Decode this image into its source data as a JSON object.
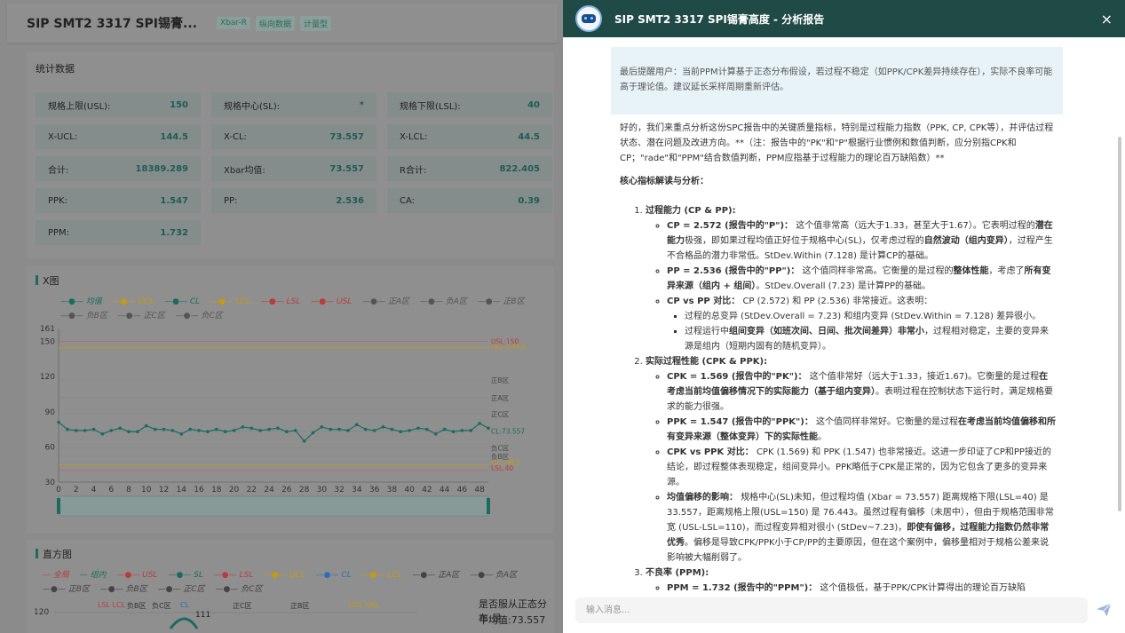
{
  "header": {
    "title": "SIP SMT2 3317 SPI锡膏...",
    "tags": [
      "Xbar-R",
      "纵向数据",
      "计量型"
    ]
  },
  "stats": {
    "title": "统计数据",
    "items": [
      {
        "label": "规格上限(USL):",
        "value": "150"
      },
      {
        "label": "规格中心(SL):",
        "value": "*"
      },
      {
        "label": "规格下限(LSL):",
        "value": "40"
      },
      {
        "label": "X-UCL:",
        "value": "144.5"
      },
      {
        "label": "X-CL:",
        "value": "73.557"
      },
      {
        "label": "X-LCL:",
        "value": "44.5"
      },
      {
        "label": "合计:",
        "value": "18389.289"
      },
      {
        "label": "Xbar均值:",
        "value": "73.557"
      },
      {
        "label": "R合计:",
        "value": "822.405"
      },
      {
        "label": "PPK:",
        "value": "1.547"
      },
      {
        "label": "PP:",
        "value": "2.536"
      },
      {
        "label": "CA:",
        "value": "0.39"
      },
      {
        "label": "PPM:",
        "value": "1.732"
      }
    ]
  },
  "xchart": {
    "title": "X图",
    "legend": [
      "均值",
      "UCL",
      "CL",
      "LCL",
      "LSL",
      "USL",
      "正A区",
      "负A区",
      "正B区",
      "负B区",
      "正C区",
      "负C区"
    ],
    "line_labels": [
      "USL:150",
      "UCL:144.5",
      "正B区",
      "正A区",
      "正C区",
      "CL:73.557",
      "负C区",
      "负B区",
      "LCL:44.5",
      "LSL:40"
    ]
  },
  "chart_data": {
    "type": "line",
    "title": "X图",
    "x": [
      0,
      1,
      2,
      3,
      4,
      5,
      6,
      7,
      8,
      9,
      10,
      11,
      12,
      13,
      14,
      15,
      16,
      17,
      18,
      19,
      20,
      21,
      22,
      23,
      24,
      25,
      26,
      27,
      28,
      29,
      30,
      31,
      32,
      33,
      34,
      35,
      36,
      37,
      38,
      39,
      40,
      41,
      42,
      43,
      44,
      45,
      46,
      47,
      48,
      49
    ],
    "series": [
      {
        "name": "均值",
        "values": [
          81,
          75,
          74,
          74,
          75,
          71,
          74,
          76,
          73,
          73,
          78,
          75,
          75,
          74,
          71,
          75,
          74,
          73,
          75,
          73,
          74,
          77,
          76,
          74,
          75,
          76,
          73,
          74,
          65,
          72,
          77,
          75,
          75,
          74,
          79,
          75,
          74,
          77,
          75,
          73,
          74,
          76,
          75,
          71,
          75,
          73,
          74,
          74,
          80,
          76
        ]
      }
    ],
    "reference_lines": [
      {
        "name": "USL",
        "value": 150
      },
      {
        "name": "UCL",
        "value": 144.5
      },
      {
        "name": "CL",
        "value": 73.557
      },
      {
        "name": "LCL",
        "value": 44.5
      },
      {
        "name": "LSL",
        "value": 40
      }
    ],
    "ylim": [
      30,
      161
    ],
    "yticks": [
      30,
      60,
      90,
      120,
      150,
      161
    ],
    "xticks": [
      0,
      2,
      4,
      6,
      8,
      10,
      12,
      14,
      16,
      18,
      20,
      22,
      24,
      26,
      28,
      30,
      32,
      34,
      36,
      38,
      40,
      42,
      44,
      46,
      48
    ]
  },
  "histogram": {
    "title": "直方图",
    "legend": [
      "全局",
      "组内",
      "USL",
      "SL",
      "LSL",
      "UCL",
      "CL",
      "LCL",
      "正A区",
      "负A区",
      "正B区",
      "负B区",
      "正C区",
      "负C区"
    ],
    "axis_top_labels": [
      "LSL LCL",
      "负B区",
      "负C区",
      "CL",
      "正C区",
      "正B区",
      "UCL USL"
    ],
    "y_tick": "120",
    "peak_label": "111",
    "right_text": [
      "是否服从正态分布:是",
      "平均值:73.557"
    ]
  },
  "panel": {
    "title": "SIP SMT2 3317 SPI锡膏高度 - 分析报告",
    "close": "×",
    "note": "最后提醒用户：当前PPM计算基于正态分布假设，若过程不稳定（如PPK/CPK差异持续存在），实际不良率可能高于理论值。建议延长采样周期重新评估。",
    "intro": "好的，我们来重点分析这份SPC报告中的关键质量指标，特别是过程能力指数（PPK, CP, CPK等），并评估过程状态、潜在问题及改进方向。**（注：报告中的\"PK\"和\"P\"根据行业惯例和数值判断，应分别指CPK和CP；\"rade\"和\"PPM\"结合数值判断，PPM应指基于过程能力的理论百万缺陷数）**",
    "heading": "核心指标解读与分析：",
    "s1": "过程能力 (CP & PP):",
    "s1a_b": "CP = 2.572 (报告中的\"P\")：",
    "s1a": "这个值非常高（远大于1.33，甚至大于1.67）。它表明过程的",
    "s1a_b2": "潜在能力",
    "s1a2": "极强，即如果过程均值正好位于规格中心(SL)，仅考虑过程的",
    "s1a_b3": "自然波动（组内变异）",
    "s1a3": "，过程产生不合格品的潜力非常低。StDev.Within (7.128) 是计算CP的基础。",
    "s1b_b": "PP = 2.536 (报告中的\"PP\")：",
    "s1b": "这个值同样非常高。它衡量的是过程的",
    "s1b_b2": "整体性能",
    "s1b2": "，考虑了",
    "s1b_b3": "所有变异来源（组内 + 组间）",
    "s1b3": "。StDev.Overall (7.23) 是计算PP的基础。",
    "s1c_b": "CP vs PP 对比：",
    "s1c": "CP (2.572) 和 PP (2.536) 非常接近。这表明：",
    "s1c1": "过程的总变异 (StDev.Overall = 7.23) 和组内变异 (StDev.Within = 7.128) 差异很小。",
    "s1c2a": "过程运行中",
    "s1c2_b": "组间变异（如班次间、日间、批次间差异）非常小",
    "s1c2": "，过程相对稳定，主要的变异来源是组内（短期内固有的随机变异）。",
    "s2": "实际过程性能 (CPK & PPK):",
    "s2a_b": "CPK = 1.569 (报告中的\"PK\")：",
    "s2a": "这个值非常好（远大于1.33，接近1.67)。它衡量的是过程",
    "s2a_b2": "在考虑当前均值偏移情况下的实际能力（基于组内变异）",
    "s2a2": "。表明过程在控制状态下运行时，满足规格要求的能力很强。",
    "s2b_b": "PPK = 1.547 (报告中的\"PPK\")：",
    "s2b": "这个值同样非常好。它衡量的是过程",
    "s2b_b2": "在考虑当前均值偏移和所有变异来源（整体变异）下的实际性能",
    "s2b2": "。",
    "s2c_b": "CPK vs PPK 对比：",
    "s2c": "CPK (1.569) 和 PPK (1.547) 也非常接近。这进一步印证了CP和PP接近的结论，即过程整体表现稳定，组间变异小。PPK略低于CPK是正常的，因为它包含了更多的变异来源。",
    "s2d_b": "均值偏移的影响：",
    "s2d": "规格中心(SL)未知，但过程均值 (Xbar = 73.557) 距离规格下限(LSL=40) 是 33.557，距离规格上限(USL=150) 是 76.443。虽然过程有偏移（未居中），但由于规格范围非常宽 (USL-LSL=110)，而过程变异相对很小 (StDev~7.23)，",
    "s2d_b2": "即使有偏移，过程能力指数仍然非常优秀",
    "s2d2": "。偏移是导致CPK/PPK小于CP/PP的主要原因，但在这个案例中，偏移量相对于规格公差来说影响被大幅削弱了。",
    "s3": "不良率 (PPM):",
    "s3a_b": "PPM = 1.732 (报告中的\"PPM\")：",
    "s3a": "这个值极低，基于PPK/CPK计算得出的理论百万缺陷",
    "input_placeholder": "输入消息..."
  }
}
